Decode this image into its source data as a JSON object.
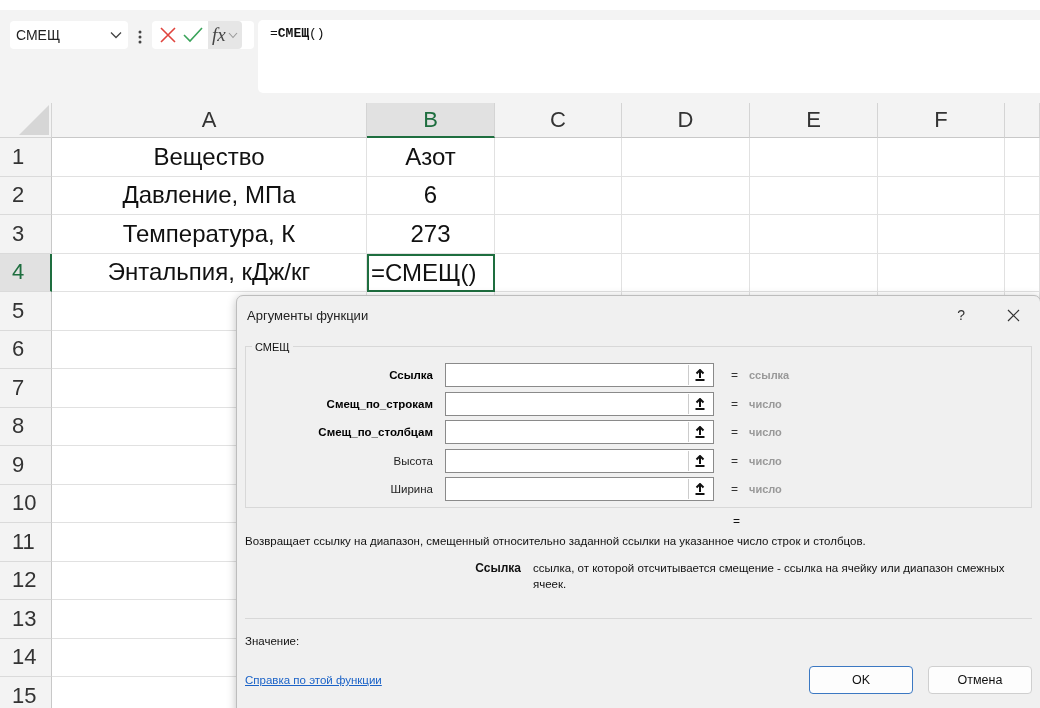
{
  "formula_bar": {
    "name_box": "СМЕЩ",
    "fx_label": "fx",
    "formula": "=**СМЕЩ**()"
  },
  "sheet": {
    "columns": [
      {
        "label": "A",
        "selected": false
      },
      {
        "label": "B",
        "selected": true
      },
      {
        "label": "C",
        "selected": false
      },
      {
        "label": "D",
        "selected": false
      },
      {
        "label": "E",
        "selected": false
      },
      {
        "label": "F",
        "selected": false
      }
    ],
    "rows": [
      {
        "label": "1",
        "selected": false,
        "cells": [
          {
            "text": "Вещество",
            "selected": false
          },
          {
            "text": "Азот",
            "selected": false
          }
        ]
      },
      {
        "label": "2",
        "selected": false,
        "cells": [
          {
            "text": "Давление, МПа",
            "selected": false
          },
          {
            "text": "6",
            "selected": false
          }
        ]
      },
      {
        "label": "3",
        "selected": false,
        "cells": [
          {
            "text": "Температура, К",
            "selected": false
          },
          {
            "text": "273",
            "selected": false
          }
        ]
      },
      {
        "label": "4",
        "selected": true,
        "cells": [
          {
            "text": "Энтальпия, кДж/кг",
            "selected": false
          },
          {
            "text": "=СМЕЩ()",
            "selected": true
          }
        ]
      },
      {
        "label": "5",
        "selected": false
      },
      {
        "label": "6",
        "selected": false
      },
      {
        "label": "7",
        "selected": false
      },
      {
        "label": "8",
        "selected": false
      },
      {
        "label": "9",
        "selected": false
      },
      {
        "label": "10",
        "selected": false
      },
      {
        "label": "11",
        "selected": false
      },
      {
        "label": "12",
        "selected": false
      },
      {
        "label": "13",
        "selected": false
      },
      {
        "label": "14",
        "selected": false
      },
      {
        "label": "15",
        "selected": false
      }
    ]
  },
  "dialog": {
    "title": "Аргументы функции",
    "help": "?",
    "group_label": "СМЕЩ",
    "arguments": [
      {
        "label": "Ссылка",
        "required": true,
        "equals": "=",
        "result": "ссылка"
      },
      {
        "label": "Смещ_по_строкам",
        "required": true,
        "equals": "=",
        "result": "число"
      },
      {
        "label": "Смещ_по_столбцам",
        "required": true,
        "equals": "=",
        "result": "число"
      },
      {
        "label": "Высота",
        "required": false,
        "equals": "=",
        "result": "число"
      },
      {
        "label": "Ширина",
        "required": false,
        "equals": "=",
        "result": "число"
      }
    ],
    "formula_result": "=",
    "description": "Возвращает ссылку на диапазон, смещенный относительно заданной ссылки на указанное число строк и столбцов.",
    "argument_help": {
      "name": "Ссылка",
      "text": "ссылка, от которой отсчитывается смещение - ссылка на ячейку или диапазон смежных ячеек."
    },
    "value_label": "Значение:",
    "help_link": "Справка по этой функции",
    "buttons": [
      {
        "label": "OK",
        "default": true
      },
      {
        "label": "Отмена",
        "default": false
      }
    ]
  }
}
